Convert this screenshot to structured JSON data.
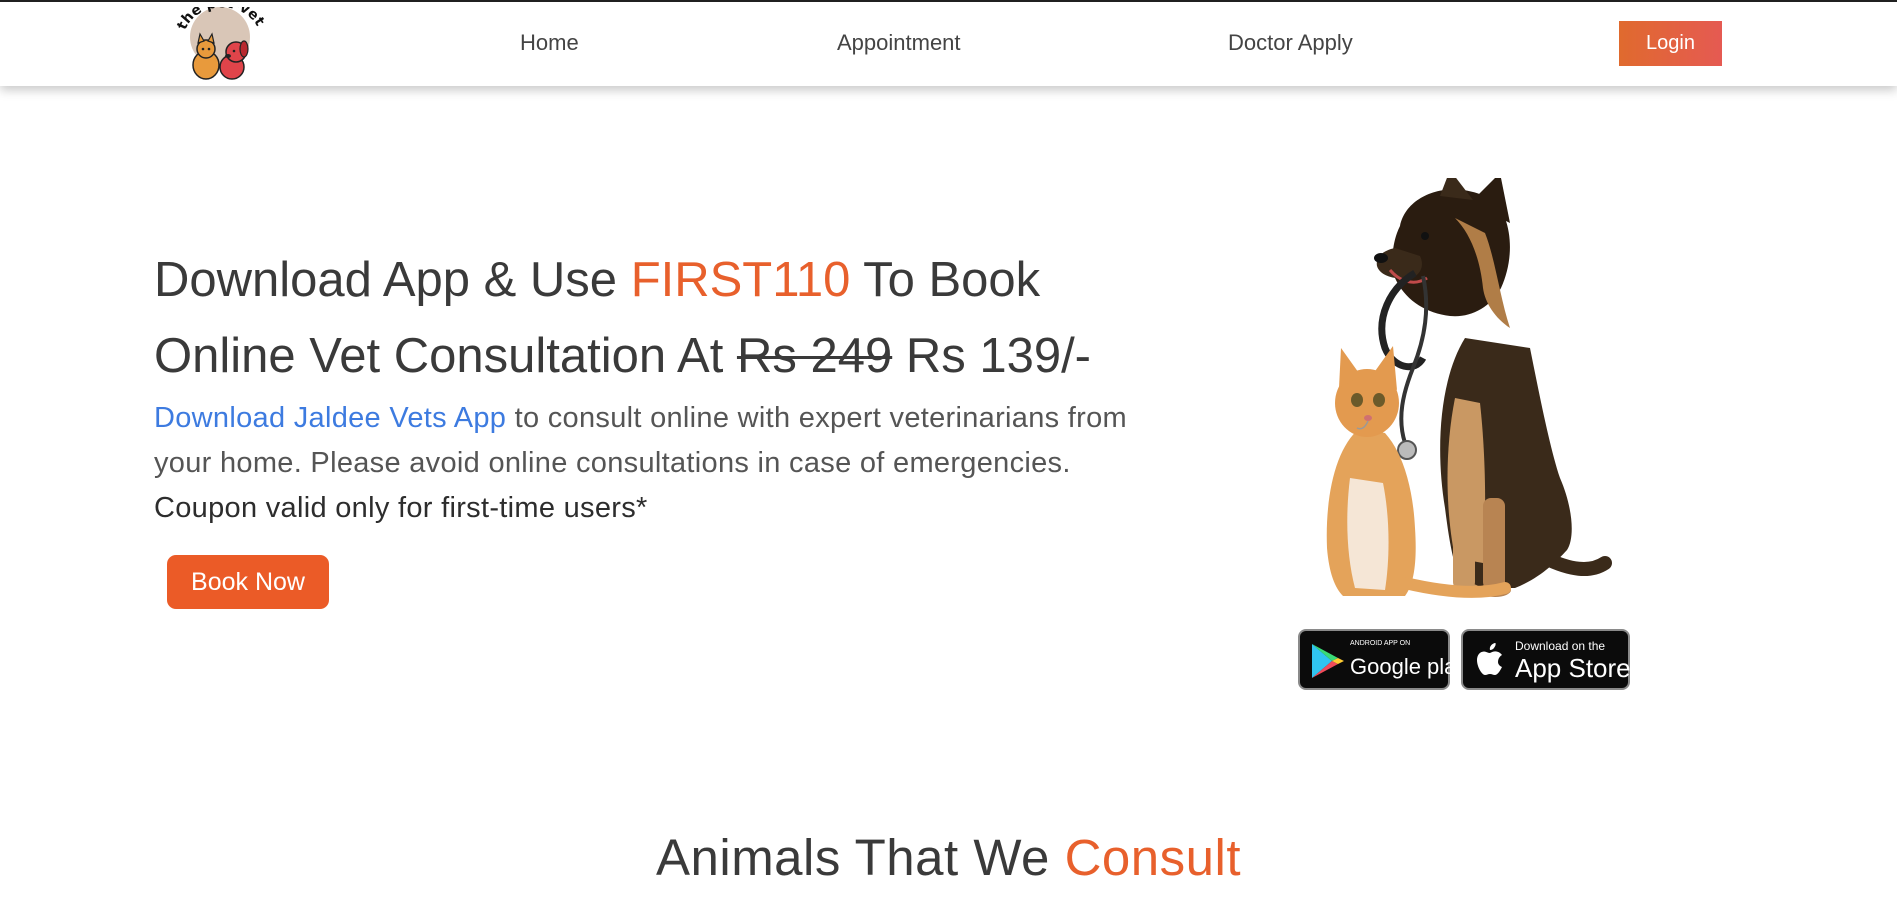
{
  "brand": {
    "logo_text": "the pet-vet"
  },
  "nav": {
    "home": "Home",
    "appointment": "Appointment",
    "doctor_apply": "Doctor Apply",
    "login": "Login"
  },
  "hero": {
    "heading_part1": "Download App & Use ",
    "coupon_code": "FIRST110",
    "heading_part2": " To Book Online Vet Consultation At ",
    "old_price": "Rs 249",
    "new_price": " Rs 139/-",
    "app_link": "Download Jaldee Vets App",
    "desc_text": " to consult online with expert veterinarians from your home. Please avoid online consultations in case of emergencies. ",
    "coupon_note": "Coupon valid only for first-time users*",
    "book_button": "Book Now"
  },
  "stores": {
    "google_small": "ANDROID APP ON",
    "google_large": "Google play",
    "apple_small": "Download on the",
    "apple_large": "App Store"
  },
  "section": {
    "title_part1": "Animals That We ",
    "title_highlight": "Consult"
  },
  "colors": {
    "accent": "#eb5b27",
    "link": "#3d7be0",
    "login_gradient_start": "#e06a2e",
    "login_gradient_end": "#e55a52"
  },
  "icons": {
    "google_play": "play-store-icon",
    "apple": "apple-icon"
  }
}
